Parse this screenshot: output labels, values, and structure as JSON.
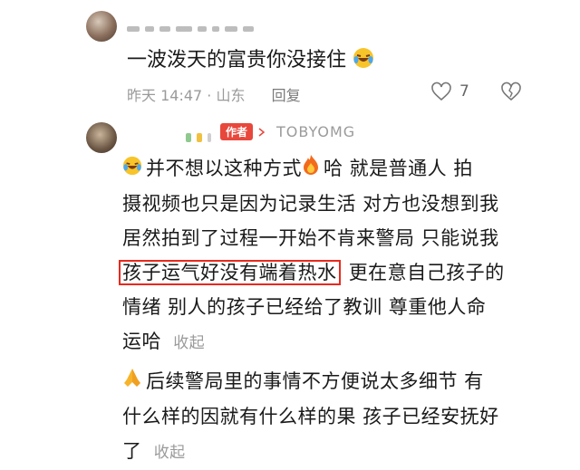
{
  "comment1": {
    "text": "一波泼天的富贵你没接住",
    "time": "昨天 14:47 · 山东",
    "reply_label": "回复",
    "like_count": "7"
  },
  "comment2": {
    "author_tag": "作者",
    "author_name": "TOBYOMG",
    "para1_line1": "并不想以这种方式",
    "para1_line1b": "哈 就是普通人 拍",
    "para1_line2": "摄视频也只是因为记录生活 对方也没想到我",
    "para1_line3": "居然拍到了过程一开始不肯来警局 只能说我",
    "para1_highlight": "孩子运气好没有端着热水",
    "para1_line4_rest": "更在意自己孩子的",
    "para1_line5": "情绪 别人的孩子已经给了教训 尊重他人命",
    "para1_line6": "运哈",
    "collapse1": "收起",
    "para2_line1": "后续警局里的事情不方便说太多细节 有",
    "para2_line2": "什么样的因就有什么样的果 孩子已经安抚好",
    "para2_line3": "了",
    "collapse2": "收起"
  }
}
